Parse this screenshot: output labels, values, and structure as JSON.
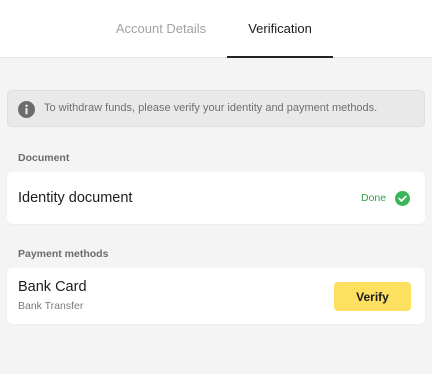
{
  "tabs": [
    {
      "label": "Account Details",
      "active": false
    },
    {
      "label": "Verification",
      "active": true
    }
  ],
  "notice": {
    "icon": "info-icon",
    "text": "To withdraw funds, please verify your identity and payment methods."
  },
  "document_section": {
    "title": "Document",
    "items": [
      {
        "label": "Identity document",
        "status": "Done",
        "status_icon": "check-circle-icon"
      }
    ]
  },
  "payment_section": {
    "title": "Payment methods",
    "items": [
      {
        "label": "Bank Card",
        "sublabel": "Bank Transfer",
        "action": "Verify"
      }
    ]
  },
  "colors": {
    "accent": "#fde060",
    "success": "#3bb55a",
    "background": "#f4f4f4"
  }
}
